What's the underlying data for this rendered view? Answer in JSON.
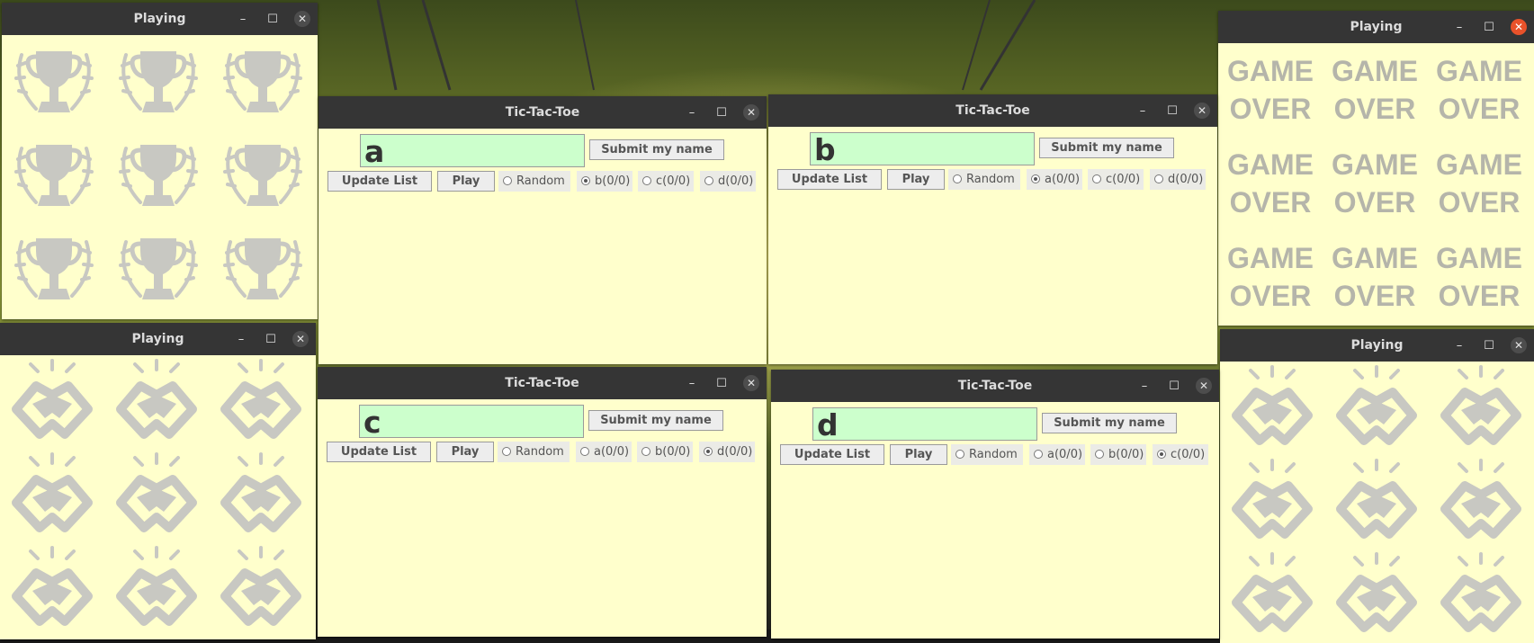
{
  "windows": {
    "playing_trophy": {
      "title": "Playing"
    },
    "playing_handshake": {
      "title": "Playing"
    },
    "playing_gameover": {
      "title": "Playing",
      "cell_text": "GAME OVER"
    },
    "playing_handshake_right": {
      "title": "Playing"
    },
    "ttt_a": {
      "title": "Tic-Tac-Toe",
      "name_value": "a",
      "submit_label": "Submit my name",
      "update_label": "Update List",
      "play_label": "Play",
      "options": [
        {
          "label": "Random",
          "checked": false
        },
        {
          "label": "b(0/0)",
          "checked": true
        },
        {
          "label": "c(0/0)",
          "checked": false
        },
        {
          "label": "d(0/0)",
          "checked": false
        }
      ]
    },
    "ttt_b": {
      "title": "Tic-Tac-Toe",
      "name_value": "b",
      "submit_label": "Submit my name",
      "update_label": "Update List",
      "play_label": "Play",
      "options": [
        {
          "label": "Random",
          "checked": false
        },
        {
          "label": "a(0/0)",
          "checked": true
        },
        {
          "label": "c(0/0)",
          "checked": false
        },
        {
          "label": "d(0/0)",
          "checked": false
        }
      ]
    },
    "ttt_c": {
      "title": "Tic-Tac-Toe",
      "name_value": "c",
      "submit_label": "Submit my name",
      "update_label": "Update List",
      "play_label": "Play",
      "options": [
        {
          "label": "Random",
          "checked": false
        },
        {
          "label": "a(0/0)",
          "checked": false
        },
        {
          "label": "b(0/0)",
          "checked": false
        },
        {
          "label": "d(0/0)",
          "checked": true
        }
      ]
    },
    "ttt_d": {
      "title": "Tic-Tac-Toe",
      "name_value": "d",
      "submit_label": "Submit my name",
      "update_label": "Update List",
      "play_label": "Play",
      "options": [
        {
          "label": "Random",
          "checked": false
        },
        {
          "label": "a(0/0)",
          "checked": false
        },
        {
          "label": "b(0/0)",
          "checked": false
        },
        {
          "label": "c(0/0)",
          "checked": true
        }
      ]
    }
  },
  "window_controls": {
    "minimize": "–",
    "maximize": "☐",
    "close": "✕"
  },
  "colors": {
    "titlebar": "#353535",
    "content_bg": "#ffffcc",
    "name_field_bg": "#ccffcc",
    "close_active": "#e9522a",
    "icon_gray": "#c8c8c2"
  },
  "icons": {
    "trophy": "trophy-icon",
    "handshake": "handshake-icon"
  }
}
